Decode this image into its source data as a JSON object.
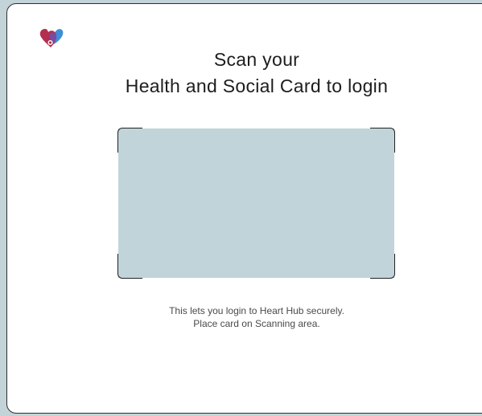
{
  "brand": {
    "logo_icon": "heart-hub-logo-icon",
    "colors": {
      "logo_red": "#b22f4f",
      "logo_blue": "#3d8fd6",
      "logo_purple": "#7a4aa0"
    }
  },
  "heading": {
    "line1": "Scan your",
    "line2": "Health and Social Card to login"
  },
  "scan_area": {
    "fill_color": "#c1d4da"
  },
  "instructions": {
    "line1": "This lets you login to Heart Hub securely.",
    "line2": "Place card on Scanning area."
  }
}
